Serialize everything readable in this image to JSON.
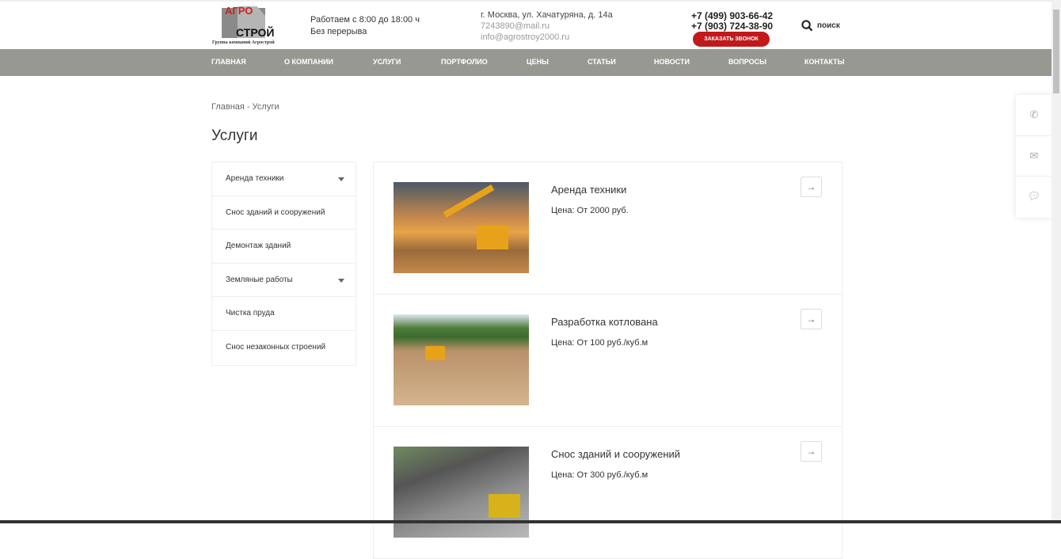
{
  "logo": {
    "line1": "АГРО",
    "line2": "СТРОЙ",
    "tagline": "Группа компаний Агрострой"
  },
  "header": {
    "hours": "Работаем с 8:00 до 18:00 ч",
    "break": "Без перерыва",
    "address": "г. Москва, ул. Хачатуряна, д. 14а",
    "email1": "7243890@mail.ru",
    "email2": "info@agrostroy2000.ru",
    "phone1": "+7 (499) 903-66-42",
    "phone2": "+7 (903) 724-38-90",
    "callback": "ЗАКАЗАТЬ ЗВОНОК",
    "search": "поиск"
  },
  "nav": [
    "ГЛАВНАЯ",
    "О КОМПАНИИ",
    "УСЛУГИ",
    "ПОРТФОЛИО",
    "ЦЕНЫ",
    "СТАТЬИ",
    "НОВОСТИ",
    "ВОПРОСЫ",
    "КОНТАКТЫ"
  ],
  "breadcrumb": {
    "home": "Главная",
    "sep": "-",
    "current": "Услуги"
  },
  "page_title": "Услуги",
  "sidebar": [
    "Аренда техники",
    "Снос зданий и сооружений",
    "Демонтаж зданий",
    "Земляные работы",
    "Чистка пруда",
    "Снос незаконных строений"
  ],
  "services": [
    {
      "title": "Аренда техники",
      "price": "Цена: От 2000 руб."
    },
    {
      "title": "Разработка котлована",
      "price": "Цена: От 100 руб./куб.м"
    },
    {
      "title": "Снос зданий и сооружений",
      "price": "Цена: От 300 руб./куб.м"
    }
  ],
  "colors": {
    "accent": "#c2191b",
    "nav": "#989893"
  }
}
